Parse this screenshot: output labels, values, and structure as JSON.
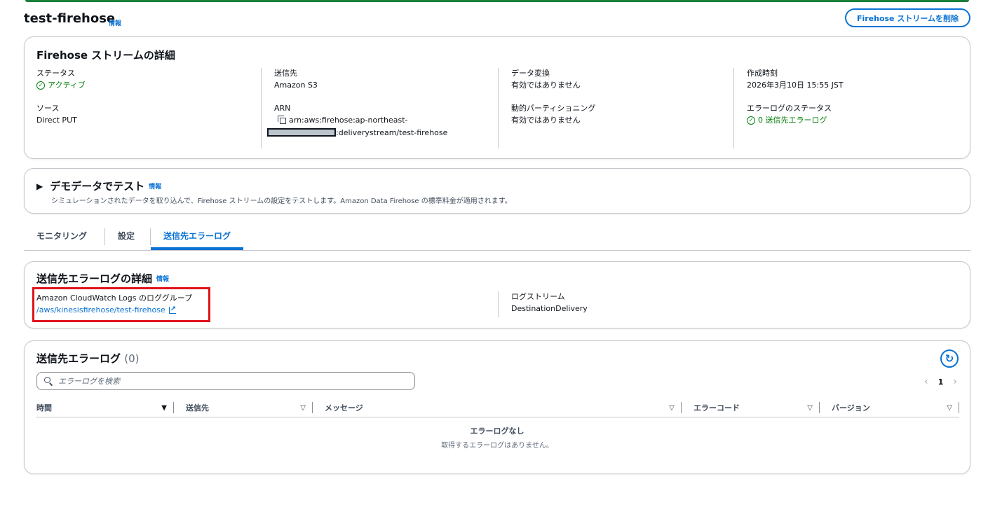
{
  "colors": {
    "accent": "#0972d3",
    "success": "#037f0c",
    "highlight": "#e0121b",
    "top_bar": "#1b7f3a"
  },
  "header": {
    "title": "test-firehose",
    "info": "情報",
    "delete_button": "Firehose ストリームを削除"
  },
  "details": {
    "title": "Firehose ストリームの詳細",
    "status_label": "ステータス",
    "status_value": "アクティブ",
    "source_label": "ソース",
    "source_value": "Direct PUT",
    "destination_label": "送信先",
    "destination_value": "Amazon S3",
    "arn_label": "ARN",
    "arn_line1": "arn:aws:firehose:ap-northeast-",
    "arn_line2": ":deliverystream/test-firehose",
    "transform_label": "データ変換",
    "transform_value": "有効ではありません",
    "partition_label": "動的パーティショニング",
    "partition_value": "有効ではありません",
    "created_label": "作成時刻",
    "created_value": "2026年3月10日 15:55 JST",
    "errstatus_label": "エラーログのステータス",
    "errstatus_value": "0 送信先エラーログ"
  },
  "demo": {
    "title": "デモデータでテスト",
    "info": "情報",
    "description": "シミュレーションされたデータを取り込んで、Firehose ストリームの設定をテストします。Amazon Data Firehose の標準料金が適用されます。"
  },
  "tabs": [
    {
      "label": "モニタリング"
    },
    {
      "label": "設定"
    },
    {
      "label": "送信先エラーログ",
      "active": true
    }
  ],
  "error_details": {
    "title": "送信先エラーログの詳細",
    "info": "情報",
    "loggroup_label": "Amazon CloudWatch Logs のロググループ",
    "loggroup_value": "/aws/kinesisfirehose/test-firehose",
    "logstream_label": "ログストリーム",
    "logstream_value": "DestinationDelivery"
  },
  "error_log": {
    "title": "送信先エラーログ",
    "count": "(0)",
    "search_placeholder": "エラーログを検索",
    "page": "1",
    "columns": [
      "時間",
      "送信先",
      "メッセージ",
      "エラーコード",
      "バージョン"
    ],
    "empty_title": "エラーログなし",
    "empty_desc": "取得するエラーログはありません。"
  }
}
